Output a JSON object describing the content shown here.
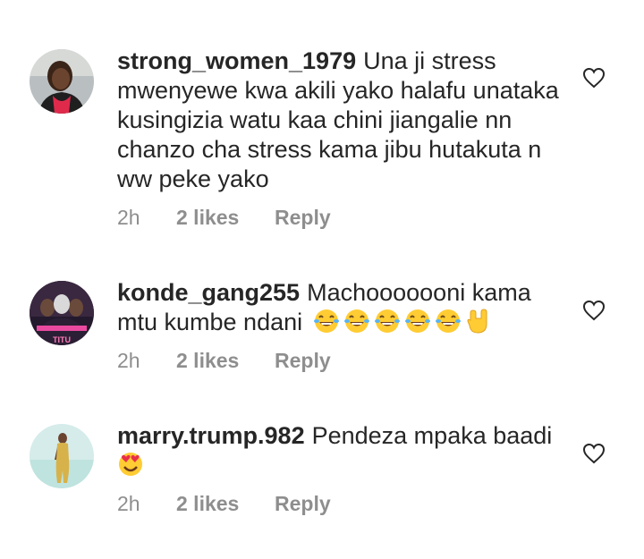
{
  "comments": [
    {
      "username": "strong_women_1979",
      "text": "Una ji stress mwenyewe kwa akili yako halafu unataka kusingizia watu kaa chini jiangalie nn chanzo cha stress kama jibu hutakuta n ww peke yako",
      "emojis": [],
      "time": "2h",
      "likes": "2 likes",
      "reply": "Reply",
      "avatar_icon": "user-photo-woman-red-top"
    },
    {
      "username": "konde_gang255",
      "text": "Machooooooni kama mtu kumbe ndani",
      "emojis": [
        "laughing-tears",
        "laughing-tears",
        "laughing-tears",
        "laughing-tears",
        "laughing-tears",
        "rock-on-hand"
      ],
      "time": "2h",
      "likes": "2 likes",
      "reply": "Reply",
      "avatar_icon": "user-photo-poster"
    },
    {
      "username": "marry.trump.982",
      "text": "Pendeza mpaka baadi",
      "emojis": [
        "heart-eyes"
      ],
      "time": "2h",
      "likes": "2 likes",
      "reply": "Reply",
      "avatar_icon": "user-photo-woman-standing"
    }
  ],
  "colors": {
    "text": "#262626",
    "meta": "#8e8e8e",
    "emoji_yellow": "#ffcc33"
  },
  "icons": {
    "like": "heart-outline-icon"
  }
}
